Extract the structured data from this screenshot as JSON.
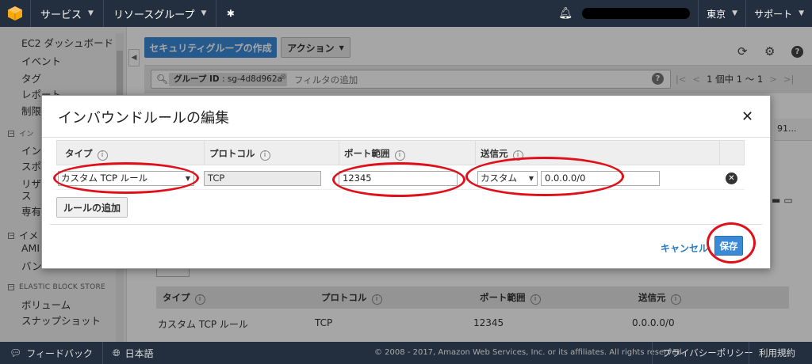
{
  "topnav": {
    "services": "サービス",
    "resource_groups": "リソースグループ",
    "region": "東京",
    "support": "サポート"
  },
  "sidebar": {
    "items": [
      "EC2 ダッシュボード",
      "イベント",
      "タグ",
      "レポート",
      "制限"
    ],
    "cropped_items": [
      "イン",
      "イン",
      "スポ",
      "リザ",
      "ス",
      "専有",
      "イメ",
      "AMI",
      "バン"
    ],
    "section_ebs": "ELASTIC BLOCK STORE",
    "ebs_items": [
      "ボリューム",
      "スナップショット"
    ]
  },
  "toolbar": {
    "create_sg": "セキュリティグループの作成",
    "actions": "アクション"
  },
  "filter": {
    "chip_label": "グループ ID",
    "chip_value": "sg-4d8d962a",
    "placeholder": "フィルタの追加"
  },
  "pager": {
    "text": "1 個中 1 〜 1"
  },
  "right_strip": {
    "text": "91..."
  },
  "bg_table": {
    "headers": [
      "タイプ",
      "プロトコル",
      "ポート範囲",
      "送信元"
    ],
    "row": [
      "カスタム TCP ルール",
      "TCP",
      "12345",
      "0.0.0.0/0"
    ]
  },
  "modal": {
    "title": "インバウンドルールの編集",
    "headers": [
      "タイプ",
      "プロトコル",
      "ポート範囲",
      "送信元"
    ],
    "row": {
      "type": "カスタム TCP ルール",
      "protocol": "TCP",
      "port": "12345",
      "source_mode": "カスタム",
      "source_cidr": "0.0.0.0/0"
    },
    "add_rule": "ルールの追加",
    "cancel": "キャンセル",
    "save": "保存"
  },
  "footer": {
    "feedback": "フィードバック",
    "language": "日本語",
    "copyright": "© 2008 - 2017, Amazon Web Services, Inc. or its affiliates. All rights reserved.",
    "privacy": "プライバシーポリシー",
    "terms": "利用規約"
  },
  "colors": {
    "nav": "#232f3e",
    "primary": "#3b8ad8",
    "annotation": "#e0101a"
  },
  "icons": [
    "aws-cube-icon",
    "pin-icon",
    "bell-icon",
    "refresh-icon",
    "gear-icon",
    "help-icon",
    "search-icon",
    "close-icon",
    "remove-rule-icon",
    "speech-bubble-icon",
    "globe-icon"
  ]
}
